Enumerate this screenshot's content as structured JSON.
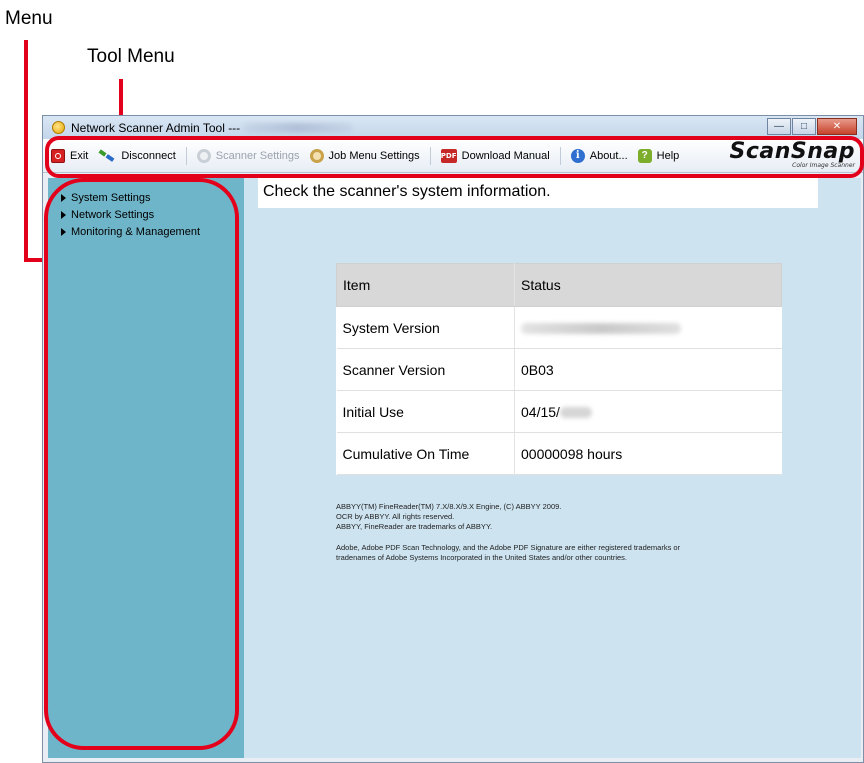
{
  "callouts": {
    "menu": "Menu",
    "tool_menu": "Tool Menu"
  },
  "window": {
    "title": "Network Scanner Admin Tool ---"
  },
  "toolbar": {
    "exit": "Exit",
    "disconnect": "Disconnect",
    "scanner_settings": "Scanner Settings",
    "job_menu_settings": "Job Menu Settings",
    "download_manual": "Download Manual",
    "about": "About...",
    "help": "Help",
    "logo": "ScanSnap",
    "logo_sub": "Color Image Scanner",
    "pdf_icon_text": "PDF",
    "info_icon_text": "i",
    "help_icon_text": "?"
  },
  "sidebar": {
    "items": [
      {
        "label": "System Settings"
      },
      {
        "label": "Network Settings"
      },
      {
        "label": "Monitoring & Management"
      }
    ]
  },
  "main": {
    "title": "Check the scanner's system information.",
    "table": {
      "headers": [
        "Item",
        "Status"
      ],
      "rows": [
        {
          "item": "System Version",
          "status": ""
        },
        {
          "item": "Scanner Version",
          "status": "0B03"
        },
        {
          "item": "Initial Use",
          "status": "04/15/"
        },
        {
          "item": "Cumulative On Time",
          "status": "00000098 hours"
        }
      ]
    },
    "notes": [
      "ABBYY(TM) FineReader(TM) 7.X/8.X/9.X Engine, (C) ABBYY 2009.",
      "OCR by ABBYY. All rights reserved.",
      "ABBYY, FineReader are trademarks of ABBYY.",
      "Adobe, Adobe PDF Scan Technology, and the Adobe PDF Signature are either registered trademarks or",
      "tradenames of Adobe Systems  Incorporated in the United States and/or other countries."
    ]
  },
  "colors": {
    "highlight": "#e3001b",
    "sidebar_bg": "#6fb5c9",
    "content_bg": "#cde3f0"
  }
}
